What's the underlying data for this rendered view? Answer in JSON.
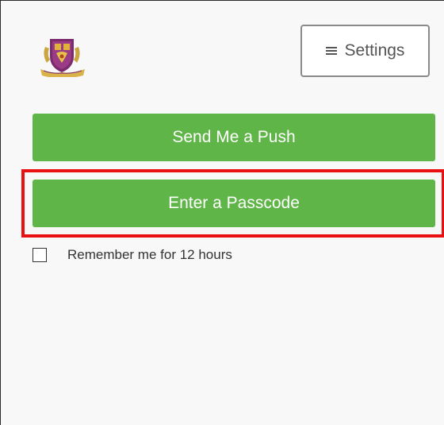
{
  "header": {
    "logo_icon": "university-crest-icon",
    "settings_label": "Settings",
    "settings_icon": "hamburger-menu-icon"
  },
  "auth": {
    "push_label": "Send Me a Push",
    "passcode_label": "Enter a Passcode",
    "remember_label": "Remember me for 12 hours",
    "remember_checked": false
  },
  "colors": {
    "button_green": "#5fb547",
    "highlight_red": "#e81010",
    "background": "#f8f8f8"
  }
}
